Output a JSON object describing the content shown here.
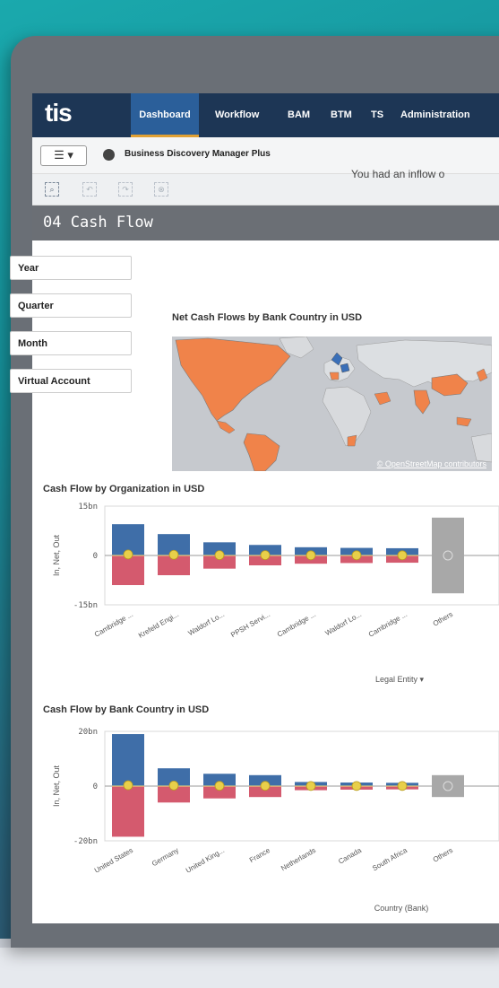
{
  "nav": {
    "logo": "tis",
    "items": [
      "Dashboard",
      "Workflow",
      "BAM",
      "BTM",
      "TS",
      "Administration"
    ],
    "active": "Dashboard"
  },
  "toolbar": {
    "menu_label": "☰ ▾",
    "app_name": "Business Discovery Manager Plus"
  },
  "sheet": {
    "title": "04 Cash Flow"
  },
  "filters": [
    "Year",
    "Quarter",
    "Month",
    "Virtual Account"
  ],
  "kpi_text": "You had an inflow o",
  "map": {
    "title": "Net Cash Flows by Bank Country in USD",
    "credit": "© OpenStreetMap contributors",
    "highlight_color": "#f0834a",
    "selected_color": "#3a6fb8"
  },
  "colors": {
    "inflow": "#3f6ea8",
    "outflow": "#d45a6e",
    "net": "#e8cf4a",
    "others": "#a8a8a8"
  },
  "chart_data": [
    {
      "type": "bar",
      "title": "Cash Flow by Organization in USD",
      "ylabel": "In, Net, Out",
      "xlabel": "Legal Entity",
      "ylim": [
        -15,
        15
      ],
      "yticks": [
        "15bn",
        "0",
        "-15bn"
      ],
      "categories": [
        "Cambridge ...",
        "Krefeld Engi...",
        "Waldorf Lo...",
        "PPSH Servi...",
        "Cambridge ...",
        "Waldorf Lo...",
        "Cambridge ...",
        "Others"
      ],
      "series": [
        {
          "name": "In",
          "values": [
            9.5,
            6.5,
            4,
            3.2,
            2.5,
            2.3,
            2.2,
            11.5
          ]
        },
        {
          "name": "Out",
          "values": [
            -9,
            -6,
            -4,
            -3,
            -2.5,
            -2.3,
            -2.2,
            -11.5
          ]
        },
        {
          "name": "Net",
          "values": [
            0.3,
            0.2,
            0.1,
            0.1,
            0.05,
            0.05,
            0.05,
            0
          ]
        }
      ]
    },
    {
      "type": "bar",
      "title": "Cash Flow by Bank Country in USD",
      "ylabel": "In, Net, Out",
      "xlabel": "Country (Bank)",
      "ylim": [
        -20,
        20
      ],
      "yticks": [
        "20bn",
        "0",
        "-20bn"
      ],
      "categories": [
        "United States",
        "Germany",
        "United King...",
        "France",
        "Netherlands",
        "Canada",
        "South Africa",
        "Others"
      ],
      "series": [
        {
          "name": "In",
          "values": [
            19,
            6.5,
            4.5,
            4,
            1.5,
            1.3,
            1.2,
            4
          ]
        },
        {
          "name": "Out",
          "values": [
            -18.5,
            -6,
            -4.5,
            -4,
            -1.5,
            -1.3,
            -1.2,
            -4
          ]
        },
        {
          "name": "Net",
          "values": [
            0.3,
            0.2,
            0.1,
            0.1,
            0.05,
            0.05,
            0.05,
            0
          ]
        }
      ]
    }
  ]
}
